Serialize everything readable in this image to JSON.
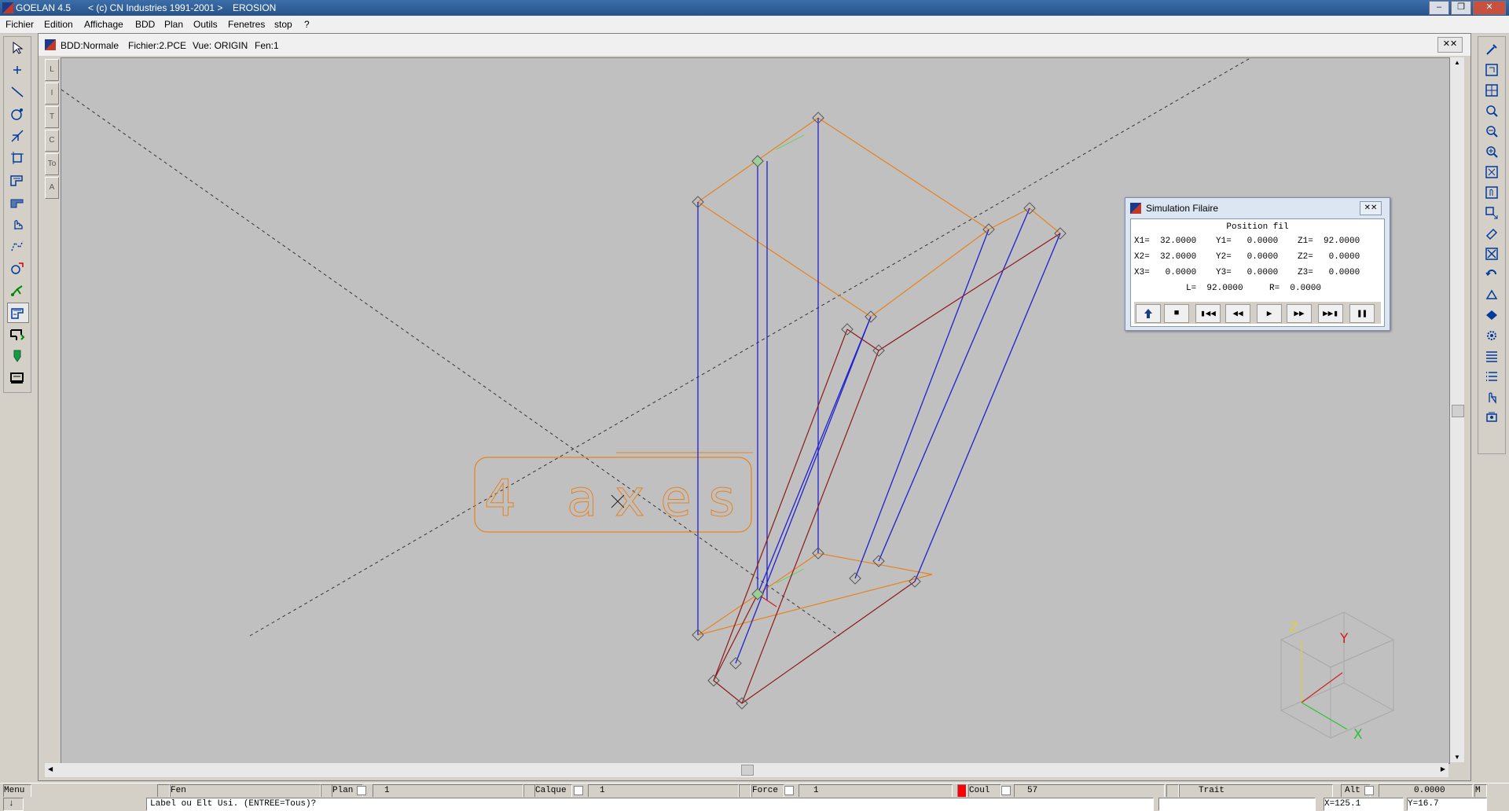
{
  "titlebar": {
    "app": "GOELAN 4.5",
    "copyright": "< (c) CN Industries 1991-2001 >",
    "module": "EROSION"
  },
  "menu": [
    "Fichier",
    "Edition",
    "Affichage",
    "BDD",
    "Plan",
    "Outils",
    "Fenetres",
    "stop",
    "?"
  ],
  "document": {
    "bdd": "BDD:Normale",
    "fichier": "Fichier:2.PCE",
    "vue": "Vue: ORIGIN",
    "fen": "Fen:1"
  },
  "side_tabs": [
    "L",
    "I",
    "T",
    "C",
    "To",
    "A"
  ],
  "canvas": {
    "text_label": "4 axes",
    "axis_labels": {
      "z": "Z",
      "y": "Y",
      "x": "X"
    }
  },
  "simulation": {
    "title": "Simulation Filaire",
    "header": "Position fil",
    "rows": [
      [
        "X1=  32.0000",
        "Y1=   0.0000",
        "Z1=  92.0000"
      ],
      [
        "X2=  32.0000",
        "Y2=   0.0000",
        "Z2=   0.0000"
      ],
      [
        "X3=   0.0000",
        "Y3=   0.0000",
        "Z3=   0.0000"
      ]
    ],
    "lr": {
      "l": "L=  92.0000",
      "r": "R=  0.0000"
    }
  },
  "status": {
    "menu": "Menu",
    "fen": "Fen",
    "plan": "Plan",
    "plan_val": "1",
    "calque": "Calque",
    "calque_val": "1",
    "force": "Force",
    "force_val": "1",
    "coul": "Coul",
    "coul_val": "57",
    "coul_color": "#ff0000",
    "trait": "Trait",
    "alt": "Alt",
    "alt_val": "0.0000",
    "m": "M",
    "prompt": "Label ou Elt Usi. (ENTREE=Tous)?",
    "prompt_prefix": "↓",
    "x": "X=125.1",
    "y": "Y=16.7"
  },
  "colors": {
    "orange": "#e8821e",
    "blue": "#2020d0",
    "darkred": "#8b1a1a",
    "canvas": "#c0c0c0"
  }
}
